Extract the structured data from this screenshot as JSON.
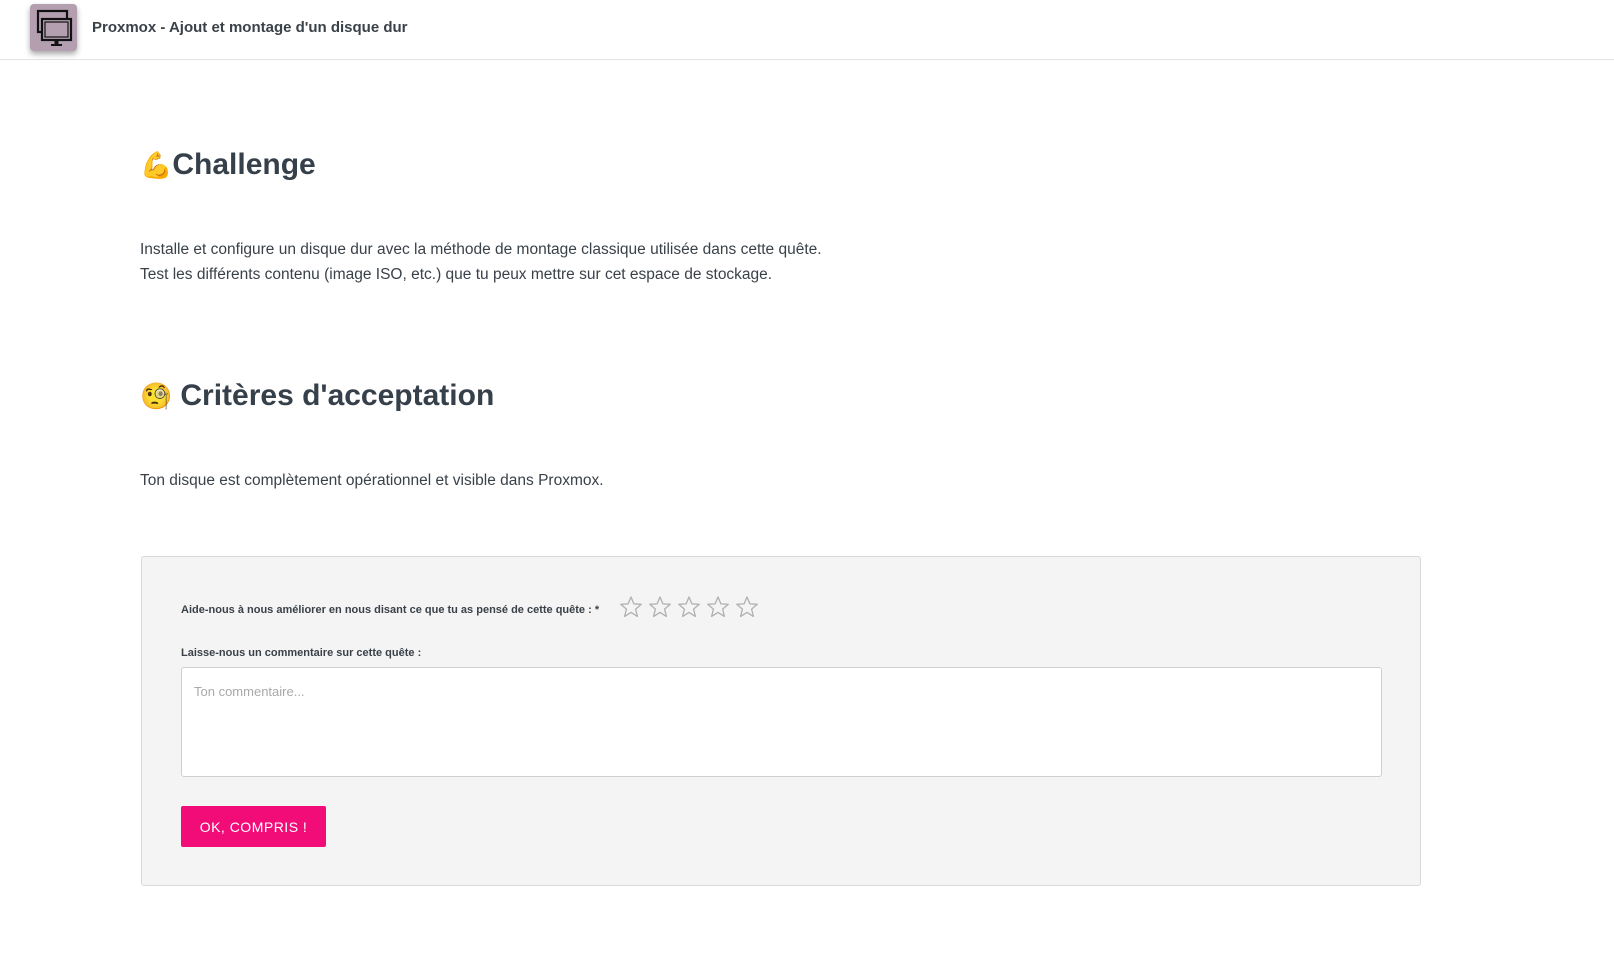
{
  "header": {
    "quest_title": "Proxmox - Ajout et montage d'un disque dur",
    "quest_icon": "computers-icon"
  },
  "challenge": {
    "emoji": "💪",
    "title": "Challenge",
    "lines": [
      "Installe et configure un disque dur avec la méthode de montage classique utilisée dans cette quête.",
      "Test les différents contenu (image ISO, etc.) que tu peux mettre sur cet espace de stockage."
    ]
  },
  "criteria": {
    "emoji": "🧐",
    "title": "Critères d'acceptation",
    "text": "Ton disque est complètement opérationnel et visible dans Proxmox."
  },
  "feedback": {
    "rating_label": "Aide-nous à nous améliorer en nous disant ce que tu as pensé de cette quête : *",
    "rating_value": 0,
    "rating_max": 5,
    "comment_label": "Laisse-nous un commentaire sur cette quête :",
    "comment_placeholder": "Ton commentaire...",
    "comment_value": "",
    "submit_label": "OK, COMPRIS !"
  },
  "colors": {
    "accent": "#f20c78",
    "icon_bg": "#b39fb0",
    "star_outline": "#b0b0b0"
  }
}
